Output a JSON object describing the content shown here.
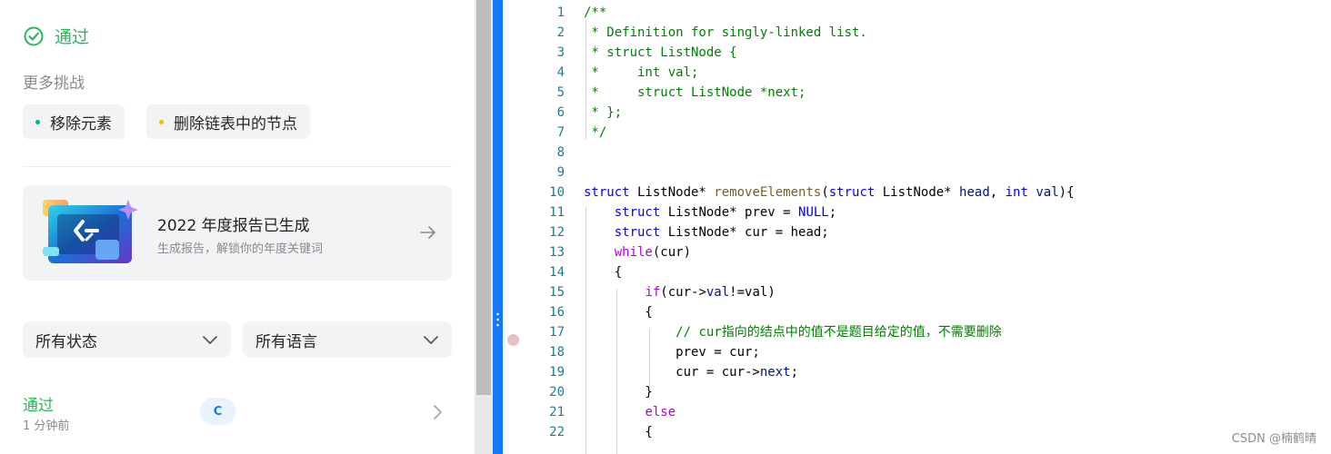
{
  "left_panel": {
    "status": "通过",
    "more_challenges_label": "更多挑战",
    "challenges": [
      {
        "label": "移除元素",
        "difficulty_color": "#00af9b"
      },
      {
        "label": "删除链表中的节点",
        "difficulty_color": "#ffb800"
      }
    ],
    "report": {
      "title": "2022 年度报告已生成",
      "subtitle": "生成报告，解锁你的年度关键词"
    },
    "filters": {
      "status_select": "所有状态",
      "language_select": "所有语言"
    },
    "submission": {
      "status": "通过",
      "time": "1 分钟前",
      "language": "C"
    }
  },
  "colors": {
    "accepted": "#2db55d",
    "splitter": "#1677ff",
    "line_number": "#237893"
  },
  "editor": {
    "breakpoint_line": 17,
    "lines": [
      {
        "n": "1",
        "tokens": [
          {
            "t": "/**",
            "c": "comment"
          }
        ]
      },
      {
        "n": "2",
        "tokens": [
          {
            "t": " * Definition for singly-linked list.",
            "c": "comment"
          }
        ]
      },
      {
        "n": "3",
        "tokens": [
          {
            "t": " * struct ListNode {",
            "c": "comment"
          }
        ]
      },
      {
        "n": "4",
        "tokens": [
          {
            "t": " *     int val;",
            "c": "comment"
          }
        ]
      },
      {
        "n": "5",
        "tokens": [
          {
            "t": " *     struct ListNode *next;",
            "c": "comment"
          }
        ]
      },
      {
        "n": "6",
        "tokens": [
          {
            "t": " * };",
            "c": "comment"
          }
        ]
      },
      {
        "n": "7",
        "tokens": [
          {
            "t": " */",
            "c": "comment"
          }
        ]
      },
      {
        "n": "8",
        "tokens": []
      },
      {
        "n": "9",
        "tokens": []
      },
      {
        "n": "10",
        "tokens": [
          {
            "t": "struct",
            "c": "kw"
          },
          {
            "t": " ListNode* ",
            "c": "plain"
          },
          {
            "t": "removeElements",
            "c": "fn"
          },
          {
            "t": "(",
            "c": "plain"
          },
          {
            "t": "struct",
            "c": "kw"
          },
          {
            "t": " ListNode* ",
            "c": "plain"
          },
          {
            "t": "head",
            "c": "var"
          },
          {
            "t": ", ",
            "c": "plain"
          },
          {
            "t": "int",
            "c": "kw"
          },
          {
            "t": " ",
            "c": "plain"
          },
          {
            "t": "val",
            "c": "var"
          },
          {
            "t": "){",
            "c": "plain"
          }
        ]
      },
      {
        "n": "11",
        "tokens": [
          {
            "t": "    ",
            "c": "plain"
          },
          {
            "t": "struct",
            "c": "kw"
          },
          {
            "t": " ListNode* prev = ",
            "c": "plain"
          },
          {
            "t": "NULL",
            "c": "kw"
          },
          {
            "t": ";",
            "c": "plain"
          }
        ]
      },
      {
        "n": "12",
        "tokens": [
          {
            "t": "    ",
            "c": "plain"
          },
          {
            "t": "struct",
            "c": "kw"
          },
          {
            "t": " ListNode* cur = head;",
            "c": "plain"
          }
        ]
      },
      {
        "n": "13",
        "tokens": [
          {
            "t": "    ",
            "c": "plain"
          },
          {
            "t": "while",
            "c": "ctrl"
          },
          {
            "t": "(cur)",
            "c": "plain"
          }
        ]
      },
      {
        "n": "14",
        "tokens": [
          {
            "t": "    {",
            "c": "plain"
          }
        ]
      },
      {
        "n": "15",
        "tokens": [
          {
            "t": "        ",
            "c": "plain"
          },
          {
            "t": "if",
            "c": "ctrl"
          },
          {
            "t": "(cur->",
            "c": "plain"
          },
          {
            "t": "val",
            "c": "var"
          },
          {
            "t": "!=val)",
            "c": "plain"
          }
        ]
      },
      {
        "n": "16",
        "tokens": [
          {
            "t": "        {",
            "c": "plain"
          }
        ]
      },
      {
        "n": "17",
        "tokens": [
          {
            "t": "            ",
            "c": "plain"
          },
          {
            "t": "// cur指向的结点中的值不是题目给定的值，不需要删除",
            "c": "comment"
          }
        ]
      },
      {
        "n": "18",
        "tokens": [
          {
            "t": "            prev = cur;",
            "c": "plain"
          }
        ]
      },
      {
        "n": "19",
        "tokens": [
          {
            "t": "            cur = cur->",
            "c": "plain"
          },
          {
            "t": "next",
            "c": "var"
          },
          {
            "t": ";",
            "c": "plain"
          }
        ]
      },
      {
        "n": "20",
        "tokens": [
          {
            "t": "        }",
            "c": "plain"
          }
        ]
      },
      {
        "n": "21",
        "tokens": [
          {
            "t": "        ",
            "c": "plain"
          },
          {
            "t": "else",
            "c": "ctrl"
          }
        ]
      },
      {
        "n": "22",
        "tokens": [
          {
            "t": "        {",
            "c": "plain"
          }
        ]
      }
    ]
  },
  "watermark": "CSDN @楠鹤晴"
}
